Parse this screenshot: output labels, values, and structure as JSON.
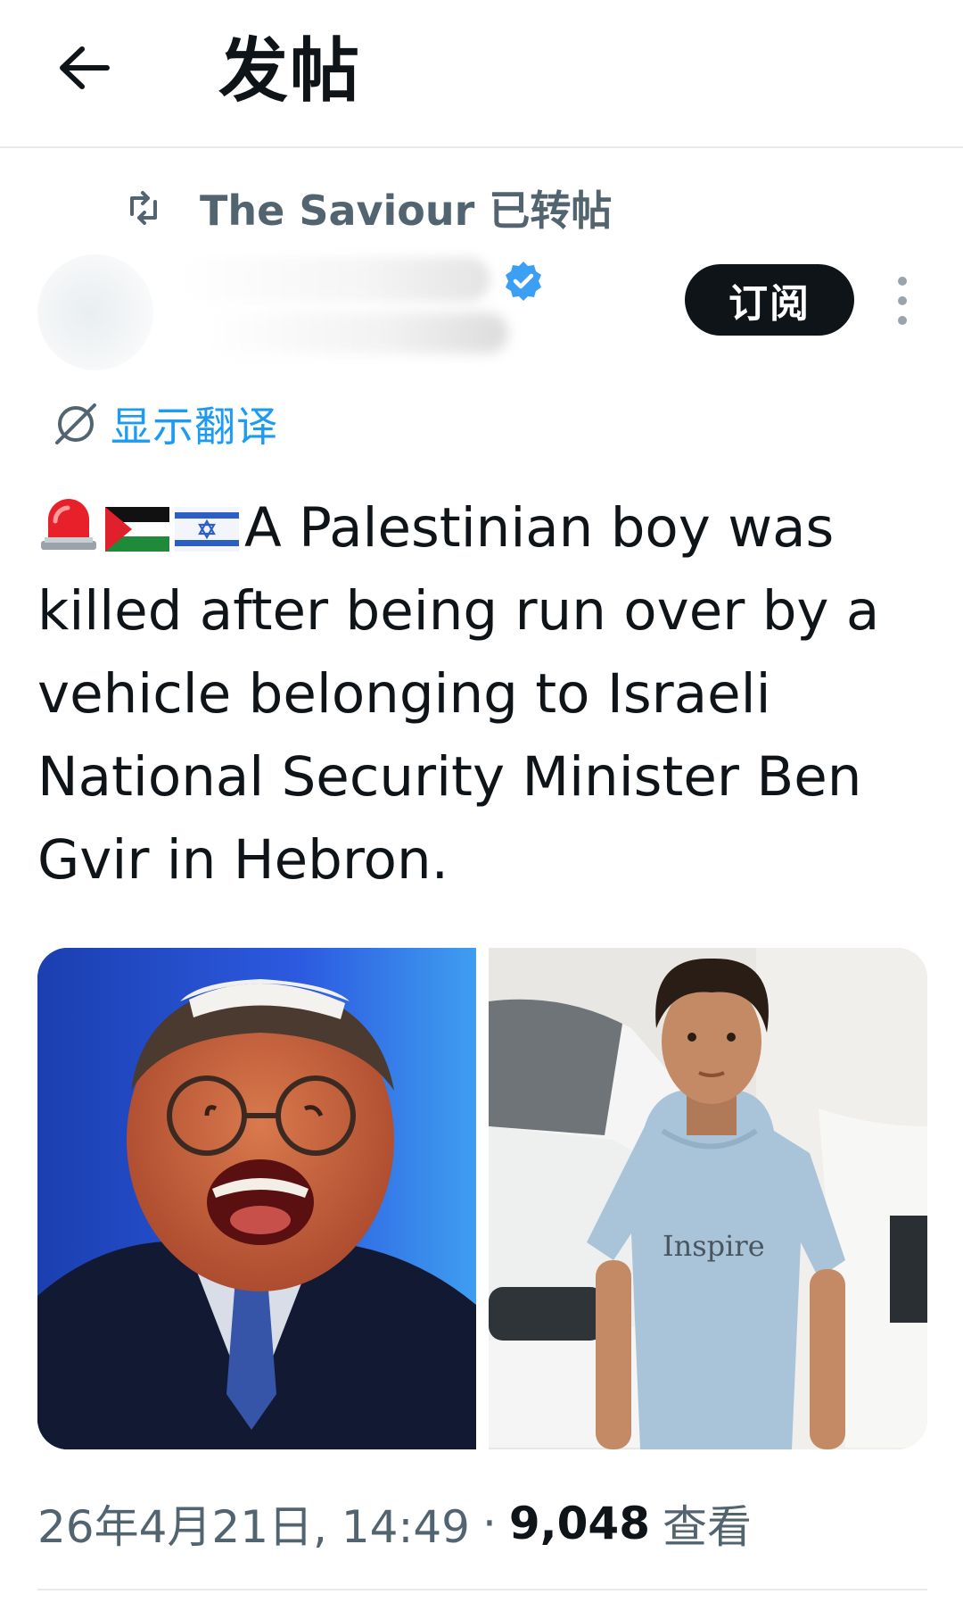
{
  "header": {
    "title": "发帖",
    "back_icon": "arrow-left-icon"
  },
  "repost": {
    "text": "The Saviour 已转帖",
    "icon": "repost-icon"
  },
  "author": {
    "subscribe_label": "订阅",
    "verified_icon": "verified-badge-icon",
    "more_icon": "more-vertical-icon"
  },
  "translate": {
    "label": "显示翻译",
    "icon": "translate-globe-icon"
  },
  "post": {
    "text": "A Palestinian boy was killed after being run over by a vehicle belonging to Israeli National Security Minister Ben Gvir in Hebron.",
    "emojis": [
      "siren-emoji",
      "palestine-flag-emoji",
      "israel-flag-emoji"
    ]
  },
  "media": {
    "left_image": "photo of a man in a kippah shouting, blue background",
    "right_image": "photo of a boy in a light blue t-shirt standing in front of a white car",
    "right_shirt_text": "Inspire"
  },
  "meta": {
    "datetime": "26年4月21日, 14:49",
    "separator": "·",
    "views": "9,048",
    "views_label": "查看"
  },
  "colors": {
    "text": "#0f1419",
    "secondary": "#536471",
    "link": "#1d9bf0",
    "button_bg": "#0f1419"
  }
}
